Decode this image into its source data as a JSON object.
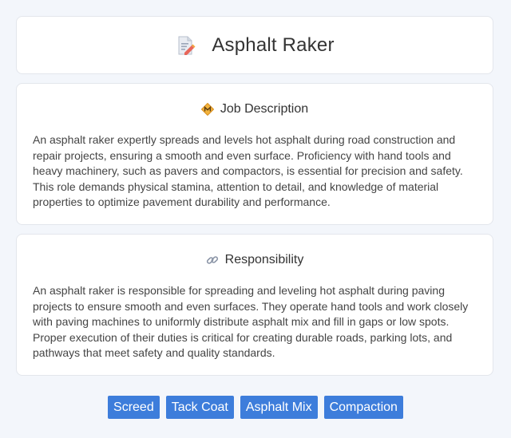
{
  "header": {
    "title": "Asphalt Raker",
    "icon": "document-pencil-icon"
  },
  "job_description": {
    "heading": "Job Description",
    "icon": "diamond-badge-icon",
    "text": "An asphalt raker expertly spreads and levels hot asphalt during road construction and repair projects, ensuring a smooth and even surface. Proficiency with hand tools and heavy machinery, such as pavers and compactors, is essential for precision and safety. This role demands physical stamina, attention to detail, and knowledge of material properties to optimize pavement durability and performance."
  },
  "responsibility": {
    "heading": "Responsibility",
    "icon": "link-icon",
    "text": "An asphalt raker is responsible for spreading and leveling hot asphalt during paving projects to ensure smooth and even surfaces. They operate hand tools and work closely with paving machines to uniformly distribute asphalt mix and fill in gaps or low spots. Proper execution of their duties is critical for creating durable roads, parking lots, and pathways that meet safety and quality standards."
  },
  "tags": [
    "Screed",
    "Tack Coat",
    "Asphalt Mix",
    "Compaction"
  ],
  "colors": {
    "tag_background": "#3d7ddb",
    "page_background": "#f3f6fb"
  }
}
